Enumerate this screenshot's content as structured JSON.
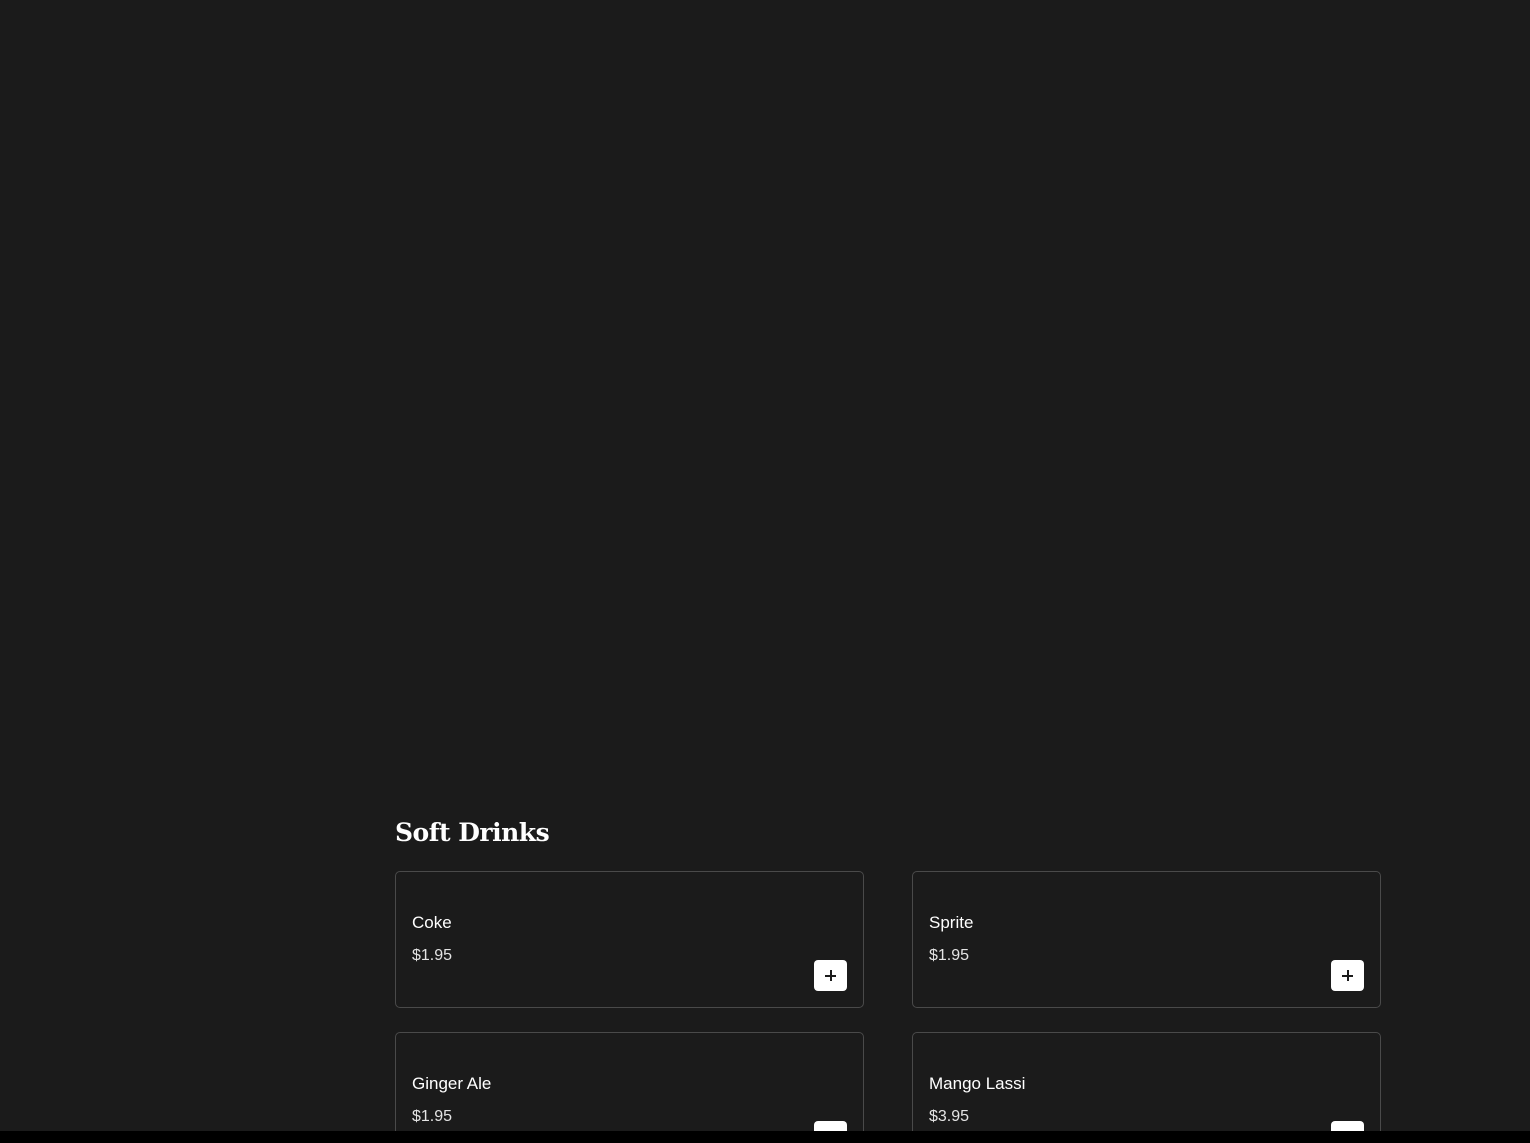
{
  "section": {
    "title": "Soft Drinks"
  },
  "items": [
    {
      "name": "Coke",
      "price": "$1.95"
    },
    {
      "name": "Sprite",
      "price": "$1.95"
    },
    {
      "name": "Ginger Ale",
      "price": "$1.95"
    },
    {
      "name": "Mango Lassi",
      "price": "$3.95"
    }
  ],
  "icons": {
    "add": "plus-icon"
  },
  "colors": {
    "background": "#1b1b1b",
    "card_border": "#4a4a4a",
    "text": "#ffffff",
    "button": "#ffffff"
  }
}
